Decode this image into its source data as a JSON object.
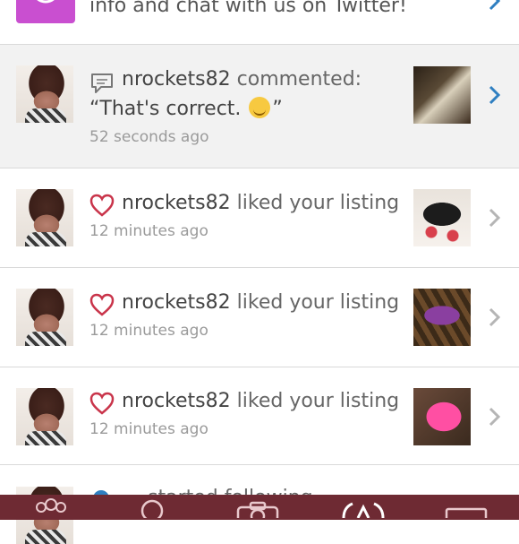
{
  "top_notice": {
    "text": "info and chat with us on Twitter!",
    "icon": "app-logo-icon",
    "accent": "#c94fd0"
  },
  "notifications": [
    {
      "type": "comment",
      "user": "nrockets82",
      "action": "commented:",
      "quote": "“That's correct.",
      "quote_end": "”",
      "time": "52 seconds ago",
      "icon": "comment-bubble-icon",
      "highlighted": true
    },
    {
      "type": "like",
      "user": "nrockets82",
      "action": "liked your listing",
      "time": "12 minutes ago",
      "icon": "heart-icon"
    },
    {
      "type": "like",
      "user": "nrockets82",
      "action": "liked your listing",
      "time": "12 minutes ago",
      "icon": "heart-icon"
    },
    {
      "type": "like",
      "user": "nrockets82",
      "action": "liked your listing",
      "time": "12 minutes ago",
      "icon": "heart-icon"
    }
  ],
  "partial_row": {
    "text": "… started following"
  },
  "colors": {
    "tabbar": "#6e2a33",
    "heart": "#c9344a",
    "chevron_active": "#2f7fc1",
    "chevron": "#b5b5b5"
  },
  "tabbar": {
    "items": [
      "community-icon",
      "search-icon",
      "camera-icon",
      "news-icon",
      "shop-icon"
    ]
  }
}
